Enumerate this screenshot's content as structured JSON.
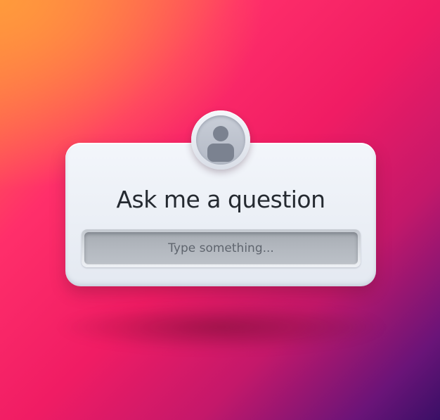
{
  "widget": {
    "title": "Ask me a question",
    "input_placeholder": "Type something...",
    "avatar_icon": "user-silhouette-icon"
  },
  "colors": {
    "background_top_left": "#ff8a3d",
    "background_center": "#f01c64",
    "background_bottom_right": "#3a0f66",
    "card": "#eef1f6",
    "title_text": "#252a31",
    "input_fill": "#b0b5bc",
    "placeholder_text": "#5f656e"
  }
}
